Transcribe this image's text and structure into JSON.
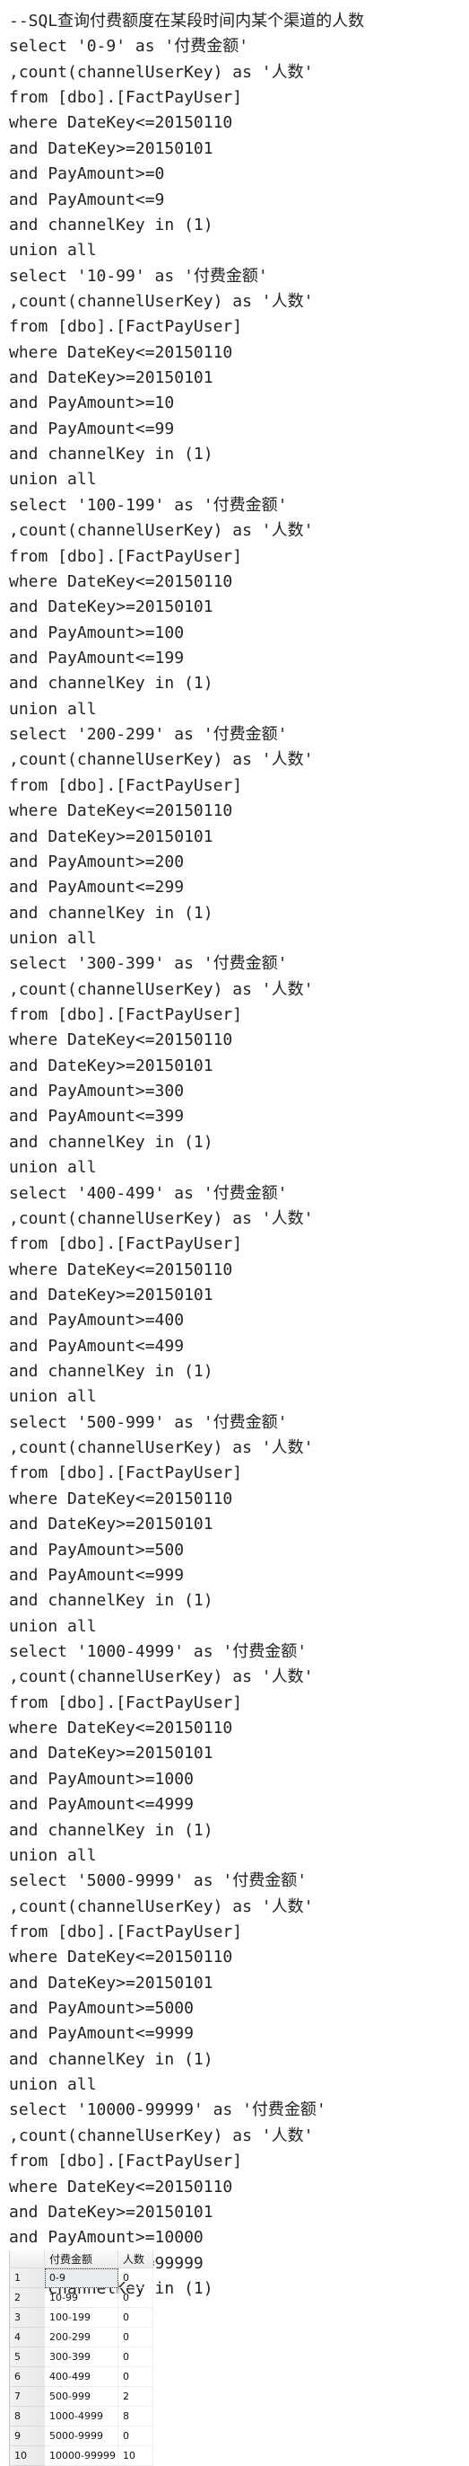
{
  "code": {
    "lines": [
      "--SQL查询付费额度在某段时间内某个渠道的人数",
      "select '0-9' as '付费金额'",
      ",count(channelUserKey) as '人数'",
      "from [dbo].[FactPayUser]",
      "where DateKey<=20150110",
      "and DateKey>=20150101",
      "and PayAmount>=0",
      "and PayAmount<=9",
      "and channelKey in (1)",
      "union all",
      "select '10-99' as '付费金额'",
      ",count(channelUserKey) as '人数'",
      "from [dbo].[FactPayUser]",
      "where DateKey<=20150110",
      "and DateKey>=20150101",
      "and PayAmount>=10",
      "and PayAmount<=99",
      "and channelKey in (1)",
      "union all",
      "select '100-199' as '付费金额'",
      ",count(channelUserKey) as '人数'",
      "from [dbo].[FactPayUser]",
      "where DateKey<=20150110",
      "and DateKey>=20150101",
      "and PayAmount>=100",
      "and PayAmount<=199",
      "and channelKey in (1)",
      "union all",
      "select '200-299' as '付费金额'",
      ",count(channelUserKey) as '人数'",
      "from [dbo].[FactPayUser]",
      "where DateKey<=20150110",
      "and DateKey>=20150101",
      "and PayAmount>=200",
      "and PayAmount<=299",
      "and channelKey in (1)",
      "union all",
      "select '300-399' as '付费金额'",
      ",count(channelUserKey) as '人数'",
      "from [dbo].[FactPayUser]",
      "where DateKey<=20150110",
      "and DateKey>=20150101",
      "and PayAmount>=300",
      "and PayAmount<=399",
      "and channelKey in (1)",
      "union all",
      "select '400-499' as '付费金额'",
      ",count(channelUserKey) as '人数'",
      "from [dbo].[FactPayUser]",
      "where DateKey<=20150110",
      "and DateKey>=20150101",
      "and PayAmount>=400",
      "and PayAmount<=499",
      "and channelKey in (1)",
      "union all",
      "select '500-999' as '付费金额'",
      ",count(channelUserKey) as '人数'",
      "from [dbo].[FactPayUser]",
      "where DateKey<=20150110",
      "and DateKey>=20150101",
      "and PayAmount>=500",
      "and PayAmount<=999",
      "and channelKey in (1)",
      "union all",
      "select '1000-4999' as '付费金额'",
      ",count(channelUserKey) as '人数'",
      "from [dbo].[FactPayUser]",
      "where DateKey<=20150110",
      "and DateKey>=20150101",
      "and PayAmount>=1000",
      "and PayAmount<=4999",
      "and channelKey in (1)",
      "union all",
      "select '5000-9999' as '付费金额'",
      ",count(channelUserKey) as '人数'",
      "from [dbo].[FactPayUser]",
      "where DateKey<=20150110",
      "and DateKey>=20150101",
      "and PayAmount>=5000",
      "and PayAmount<=9999",
      "and channelKey in (1)",
      "union all",
      "select '10000-99999' as '付费金额'",
      ",count(channelUserKey) as '人数'",
      "from [dbo].[FactPayUser]",
      "where DateKey<=20150110",
      "and DateKey>=20150101",
      "and PayAmount>=10000",
      "and PayAmount<=99999",
      "and channelKey in (1)"
    ]
  },
  "results": {
    "headers": [
      "付费金额",
      "人数"
    ],
    "rows": [
      {
        "n": "1",
        "range": "0-9",
        "count": "0"
      },
      {
        "n": "2",
        "range": "10-99",
        "count": "0"
      },
      {
        "n": "3",
        "range": "100-199",
        "count": "0"
      },
      {
        "n": "4",
        "range": "200-299",
        "count": "0"
      },
      {
        "n": "5",
        "range": "300-399",
        "count": "0"
      },
      {
        "n": "6",
        "range": "400-499",
        "count": "0"
      },
      {
        "n": "7",
        "range": "500-999",
        "count": "2"
      },
      {
        "n": "8",
        "range": "1000-4999",
        "count": "8"
      },
      {
        "n": "9",
        "range": "5000-9999",
        "count": "0"
      },
      {
        "n": "10",
        "range": "10000-99999",
        "count": "10"
      }
    ]
  }
}
